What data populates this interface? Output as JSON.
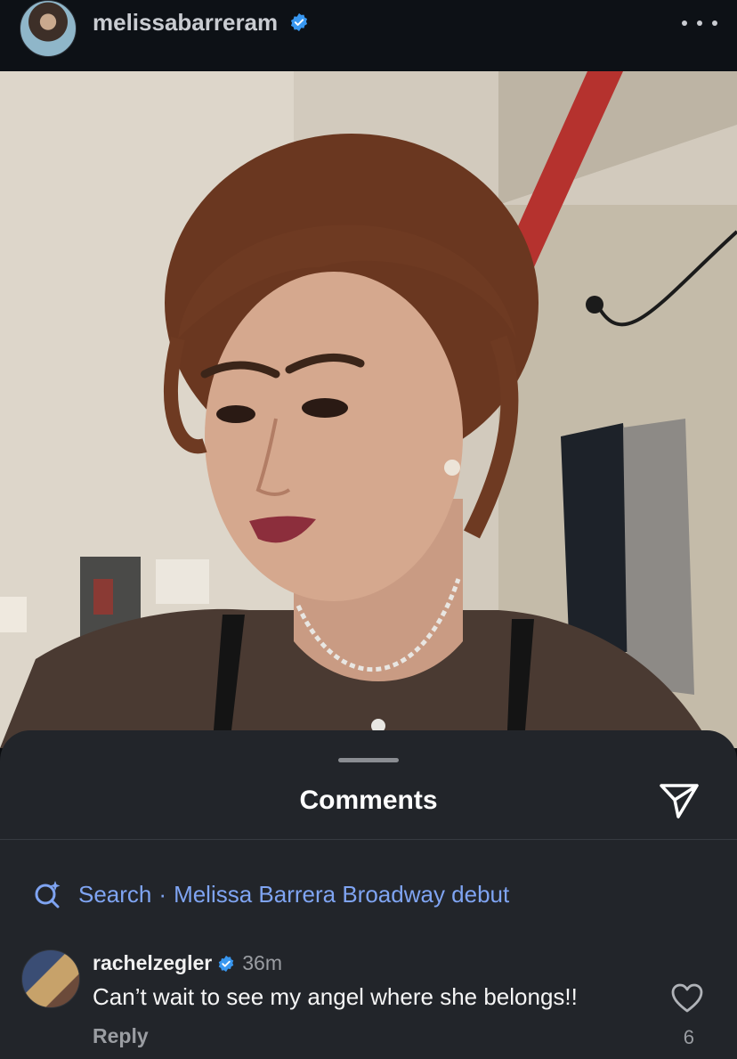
{
  "post": {
    "username": "melissabarreram",
    "verified_icon": "verified-badge-icon",
    "more_icon": "more-horizontal-icon",
    "photo_description_icon": "photo"
  },
  "comments_sheet": {
    "title": "Comments",
    "share_icon": "send-icon",
    "search": {
      "label": "Search",
      "separator": "·",
      "query": "Melissa Barrera Broadway debut"
    },
    "items": [
      {
        "username": "rachelzegler",
        "time": "36m",
        "text": "Can’t wait to see my angel where she belongs!!",
        "reply_label": "Reply",
        "likes": "6"
      }
    ]
  },
  "colors": {
    "accent_blue": "#7fa4f2",
    "verified_blue": "#3897f0",
    "sheet_bg": "#22252a"
  }
}
